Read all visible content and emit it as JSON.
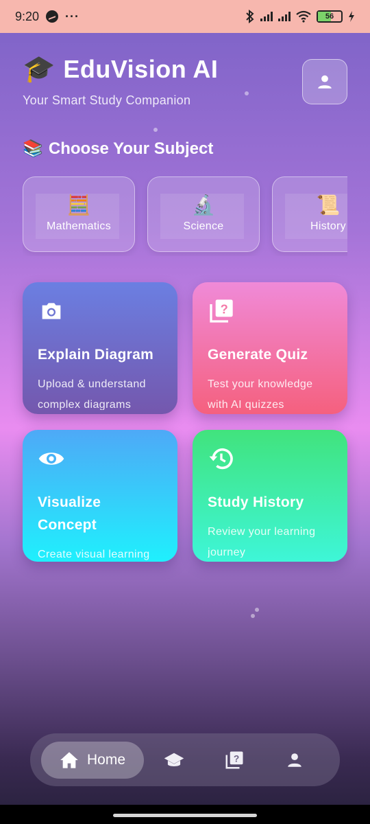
{
  "status_bar": {
    "time": "9:20",
    "dots": "···",
    "battery": "56"
  },
  "header": {
    "title_emoji": "🎓",
    "title": "EduVision AI",
    "subtitle": "Your Smart Study Companion"
  },
  "subjects_section": {
    "emoji": "📚",
    "title": "Choose Your Subject",
    "items": [
      {
        "emoji": "🧮",
        "label": "Mathematics"
      },
      {
        "emoji": "🔬",
        "label": "Science"
      },
      {
        "emoji": "📜",
        "label": "History"
      }
    ]
  },
  "features": [
    {
      "title": "Explain Diagram",
      "desc": "Upload & understand complex diagrams",
      "icon": "camera-icon"
    },
    {
      "title": "Generate Quiz",
      "desc": "Test your knowledge with AI quizzes",
      "icon": "quiz-icon"
    },
    {
      "title": "Visualize Concept",
      "desc": "Create visual learning aids",
      "icon": "eye-icon"
    },
    {
      "title": "Study History",
      "desc": "Review your learning journey",
      "icon": "history-icon"
    }
  ],
  "bottom_nav": {
    "home_label": "Home",
    "items": [
      "home-icon",
      "graduation-cap-icon",
      "quiz-icon",
      "person-icon"
    ]
  }
}
